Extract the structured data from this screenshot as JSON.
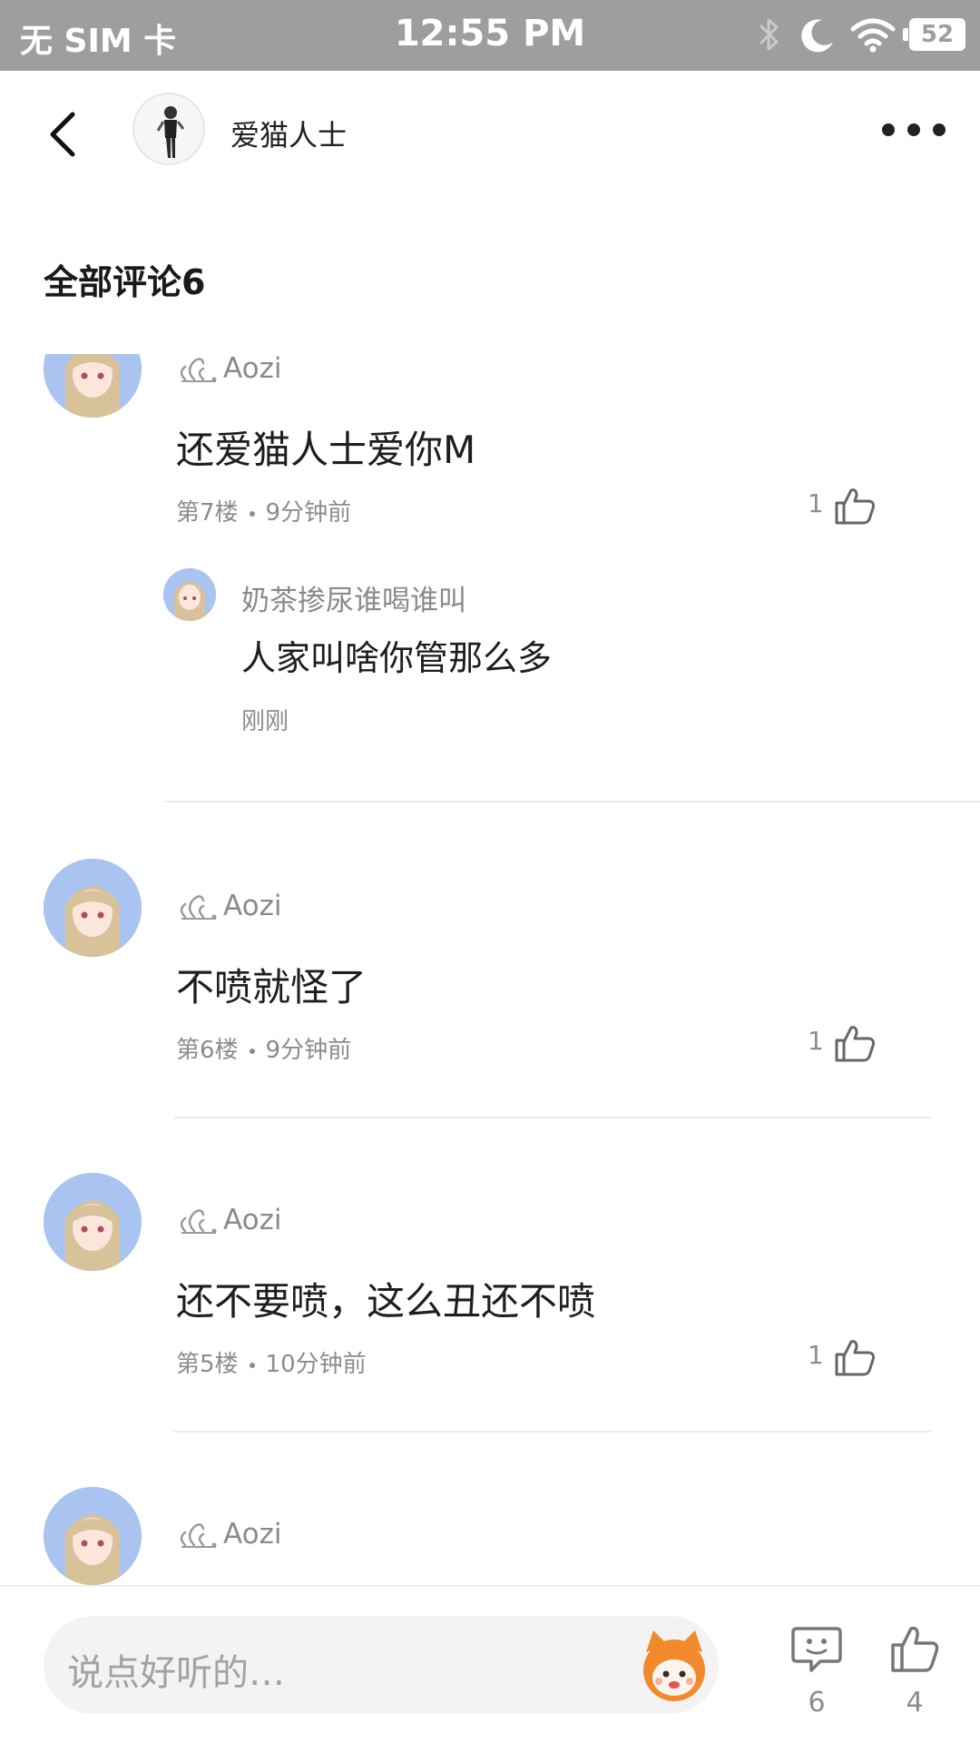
{
  "status_bar": {
    "carrier": "无 SIM 卡",
    "time": "12:55 PM",
    "battery": "52"
  },
  "header": {
    "title": "爱猫人士",
    "back_icon": "chevron-left-icon",
    "more_icon": "more-horizontal-icon"
  },
  "section": {
    "title": "全部评论6"
  },
  "comments": [
    {
      "username": "Aozi",
      "text": "还爱猫人士爱你M",
      "floor": "第7楼",
      "time": "9分钟前",
      "likes": "1",
      "reply": {
        "username": "奶茶掺尿谁喝谁叫",
        "text": "人家叫啥你管那么多",
        "time": "刚刚"
      }
    },
    {
      "username": "Aozi",
      "text": "不喷就怪了",
      "floor": "第6楼",
      "time": "9分钟前",
      "likes": "1"
    },
    {
      "username": "Aozi",
      "text": "还不要喷，这么丑还不喷",
      "floor": "第5楼",
      "time": "10分钟前",
      "likes": "1"
    },
    {
      "username": "Aozi"
    }
  ],
  "bottom_bar": {
    "input_placeholder": "说点好听的…",
    "comment_count": "6",
    "like_count": "4"
  },
  "colors": {
    "status_bar": "#9e9e9e",
    "text_primary": "#1e1e1e",
    "text_secondary": "#8c8c8c",
    "avatar_bg": "#a9c4f0",
    "mascot": "#f08a2c"
  }
}
